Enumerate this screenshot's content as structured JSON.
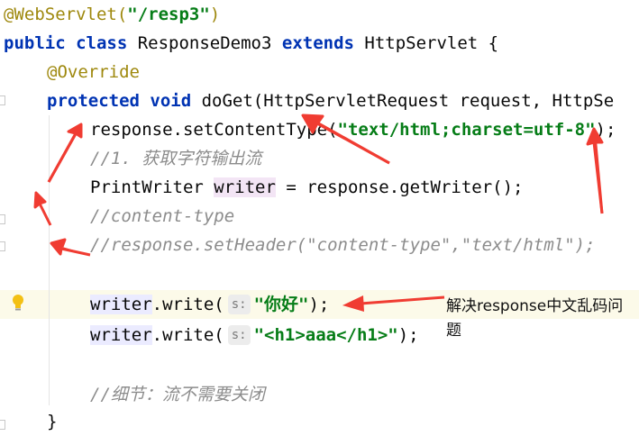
{
  "code": {
    "l1": {
      "ann": "@WebServlet(",
      "str": "\"/resp3\"",
      "close": ")"
    },
    "l2": {
      "kw1": "public class",
      "name": " ResponseDemo3 ",
      "kw2": "extends",
      "rest": " HttpServlet {"
    },
    "l3": {
      "ann": "@Override"
    },
    "l4": {
      "kw": "protected void",
      "rest": " doGet(HttpServletRequest request, HttpSe"
    },
    "l5": {
      "pre": "response.setContentType(",
      "str": "\"text/html;charset=utf-8\"",
      "post": ");"
    },
    "l6": {
      "cmt": "//1. 获取字符输出流"
    },
    "l7": {
      "pre": "PrintWriter ",
      "var": "writer",
      "post": " = response.getWriter();"
    },
    "l8": {
      "cmt": "//content-type"
    },
    "l9": {
      "cmt": "//response.setHeader(\"content-type\",\"text/html\");"
    },
    "l10": {
      "var": "writer",
      "pre": ".write(",
      "hint": "s:",
      "str": "\"你好\"",
      "post": ");"
    },
    "l11": {
      "var": "writer",
      "pre": ".write(",
      "hint": "s:",
      "str": "\"<h1>aaa</h1>\"",
      "post": ");"
    },
    "l12": {
      "cmt": "//细节：流不需要关闭"
    },
    "l13": {
      "brace": "}"
    }
  },
  "annotation_note": "解决response中文乱码问题",
  "icons": {
    "gutter": "lightbulb-icon"
  },
  "colors": {
    "arrow": "#f03c32",
    "keyword": "#0033b3",
    "string": "#067d17",
    "annotation": "#9e880d",
    "comment": "#8c8c8c"
  }
}
